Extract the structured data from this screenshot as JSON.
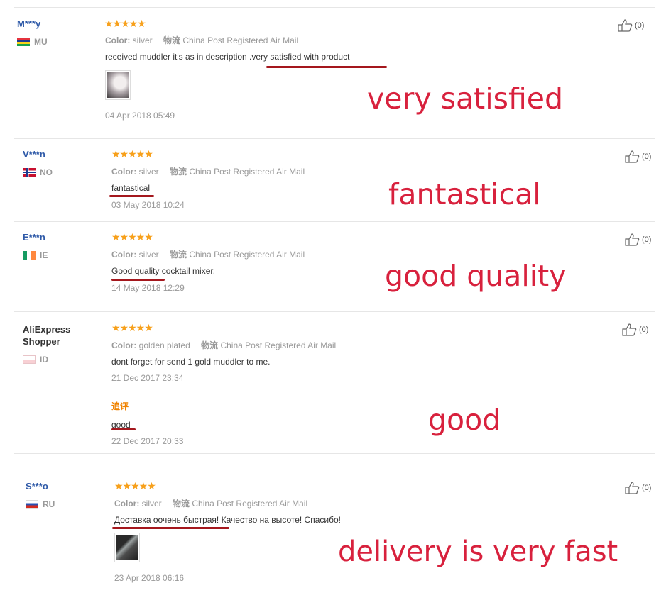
{
  "reviews": [
    {
      "author": "M***y",
      "country": "MU",
      "color_label": "Color:",
      "color_value": "silver",
      "ship_label": "物流",
      "shipping": "China Post Registered Air Mail",
      "text": "received muddler it's as in description .very satisfied with product",
      "date": "04 Apr 2018 05:49",
      "likes": "(0)",
      "annotation": "very satisfied"
    },
    {
      "author": "V***n",
      "country": "NO",
      "color_label": "Color:",
      "color_value": "silver",
      "ship_label": "物流",
      "shipping": "China Post Registered Air Mail",
      "text": "fantastical",
      "date": "03 May 2018 10:24",
      "likes": "(0)",
      "annotation": "fantastical"
    },
    {
      "author": "E***n",
      "country": "IE",
      "color_label": "Color:",
      "color_value": "silver",
      "ship_label": "物流",
      "shipping": "China Post Registered Air Mail",
      "text": "Good quality cocktail mixer.",
      "date": "14 May 2018 12:29",
      "likes": "(0)",
      "annotation": "good quality"
    },
    {
      "author": "AliExpress Shopper",
      "country": "ID",
      "color_label": "Color:",
      "color_value": "golden plated",
      "ship_label": "物流",
      "shipping": "China Post Registered Air Mail",
      "text": "dont forget for send 1 gold muddler to me.",
      "date": "21 Dec 2017 23:34",
      "likes": "(0)",
      "additional_label": "追评",
      "additional_text": "good",
      "additional_date": "22 Dec 2017 20:33",
      "annotation": "good"
    },
    {
      "author": "S***o",
      "country": "RU",
      "color_label": "Color:",
      "color_value": "silver",
      "ship_label": "物流",
      "shipping": "China Post Registered Air Mail",
      "text": "Доставка оочень быстрая! Качество на высоте! Спасибо!",
      "date": "23 Apr 2018 06:16",
      "likes": "(0)",
      "annotation": "delivery is very fast"
    }
  ],
  "stars": "★★★★★",
  "colors": {
    "annotation": "#d8213d",
    "underline": "#a4171d",
    "star": "#f7a01b",
    "author_link": "#2f5aa8"
  }
}
